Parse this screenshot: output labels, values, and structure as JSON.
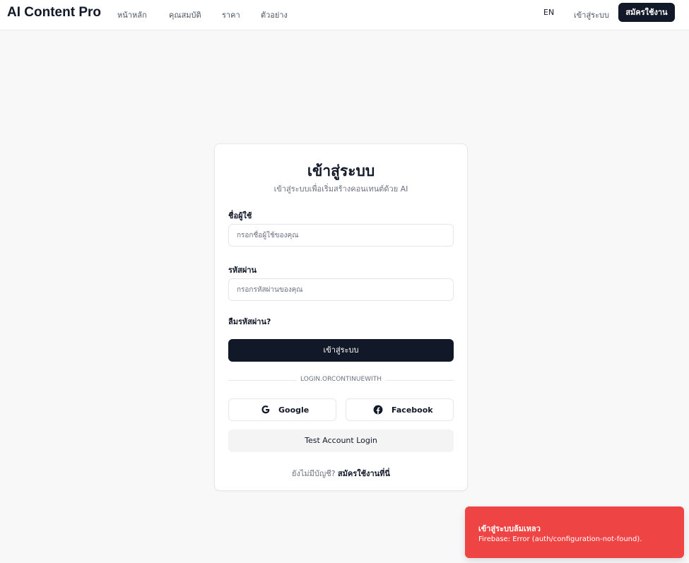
{
  "nav": {
    "brand": "AI Content Pro",
    "links": [
      "หน้าหลัก",
      "คุณสมบัติ",
      "ราคา",
      "ตัวอย่าง"
    ],
    "language": "EN",
    "login": "เข้าสู่ระบบ",
    "signup": "สมัครใช้งาน"
  },
  "login_card": {
    "title": "เข้าสู่ระบบ",
    "subtitle": "เข้าสู่ระบบเพื่อเริ่มสร้างคอนเทนต์ด้วย AI",
    "username_label": "ชื่อผู้ใช้",
    "username_placeholder": "กรอกชื่อผู้ใช้ของคุณ",
    "username_value": "",
    "password_label": "รหัสผ่าน",
    "password_placeholder": "กรอกรหัสผ่านของคุณ",
    "password_value": "",
    "forgot_password": "ลืมรหัสผ่าน?",
    "submit": "เข้าสู่ระบบ",
    "divider_text": "LOGIN.ORCONTINUEWITH",
    "google": "Google",
    "facebook": "Facebook",
    "test_account": "Test Account Login",
    "no_account": "ยังไม่มีบัญชี?",
    "signup_link": "สมัครใช้งานที่นี่"
  },
  "toast": {
    "title": "เข้าสู่ระบบล้มเหลว",
    "message": "Firebase: Error (auth/configuration-not-found).",
    "color": "#ef4444"
  },
  "colors": {
    "primary": "#111827",
    "background": "#f8f8f9",
    "border": "#e5e7eb",
    "error": "#ef4444"
  }
}
